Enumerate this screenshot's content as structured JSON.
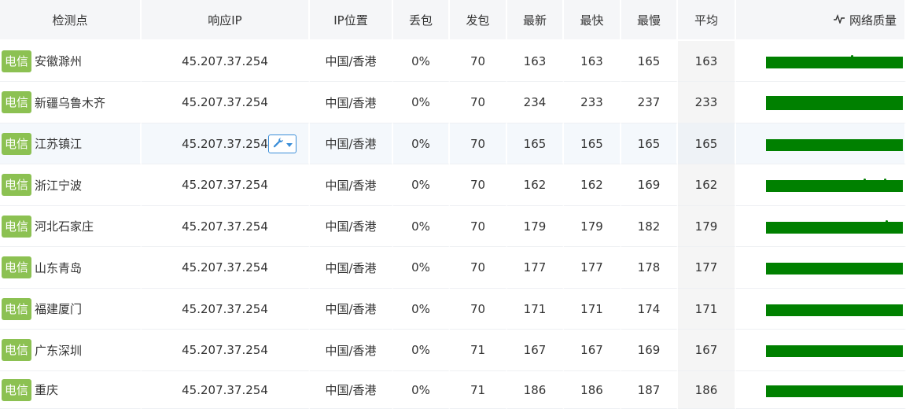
{
  "columns": {
    "node": "检测点",
    "ip": "响应IP",
    "location": "IP位置",
    "loss": "丢包",
    "sent": "发包",
    "last": "最新",
    "best": "最快",
    "worst": "最慢",
    "avg": "平均",
    "quality": "网络质量"
  },
  "colors": {
    "isp_badge": "#8cc152",
    "quality_bar": "#008000",
    "tool_button_border": "#3b8ed8"
  },
  "rows": [
    {
      "isp": "电信",
      "node": "安徽滁州",
      "ip": "45.207.37.254",
      "location": "中国/香港",
      "loss": "0%",
      "sent": "70",
      "last": "163",
      "best": "163",
      "worst": "165",
      "avg": "163"
    },
    {
      "isp": "电信",
      "node": "新疆乌鲁木齐",
      "ip": "45.207.37.254",
      "location": "中国/香港",
      "loss": "0%",
      "sent": "70",
      "last": "234",
      "best": "233",
      "worst": "237",
      "avg": "233"
    },
    {
      "isp": "电信",
      "node": "江苏镇江",
      "ip": "45.207.37.254",
      "location": "中国/香港",
      "loss": "0%",
      "sent": "70",
      "last": "165",
      "best": "165",
      "worst": "165",
      "avg": "165"
    },
    {
      "isp": "电信",
      "node": "浙江宁波",
      "ip": "45.207.37.254",
      "location": "中国/香港",
      "loss": "0%",
      "sent": "70",
      "last": "162",
      "best": "162",
      "worst": "169",
      "avg": "162"
    },
    {
      "isp": "电信",
      "node": "河北石家庄",
      "ip": "45.207.37.254",
      "location": "中国/香港",
      "loss": "0%",
      "sent": "70",
      "last": "179",
      "best": "179",
      "worst": "182",
      "avg": "179"
    },
    {
      "isp": "电信",
      "node": "山东青岛",
      "ip": "45.207.37.254",
      "location": "中国/香港",
      "loss": "0%",
      "sent": "70",
      "last": "177",
      "best": "177",
      "worst": "178",
      "avg": "177"
    },
    {
      "isp": "电信",
      "node": "福建厦门",
      "ip": "45.207.37.254",
      "location": "中国/香港",
      "loss": "0%",
      "sent": "70",
      "last": "171",
      "best": "171",
      "worst": "174",
      "avg": "171"
    },
    {
      "isp": "电信",
      "node": "广东深圳",
      "ip": "45.207.37.254",
      "location": "中国/香港",
      "loss": "0%",
      "sent": "71",
      "last": "167",
      "best": "167",
      "worst": "169",
      "avg": "167"
    },
    {
      "isp": "电信",
      "node": "重庆",
      "ip": "45.207.37.254",
      "location": "中国/香港",
      "loss": "0%",
      "sent": "71",
      "last": "186",
      "best": "186",
      "worst": "187",
      "avg": "186"
    }
  ]
}
